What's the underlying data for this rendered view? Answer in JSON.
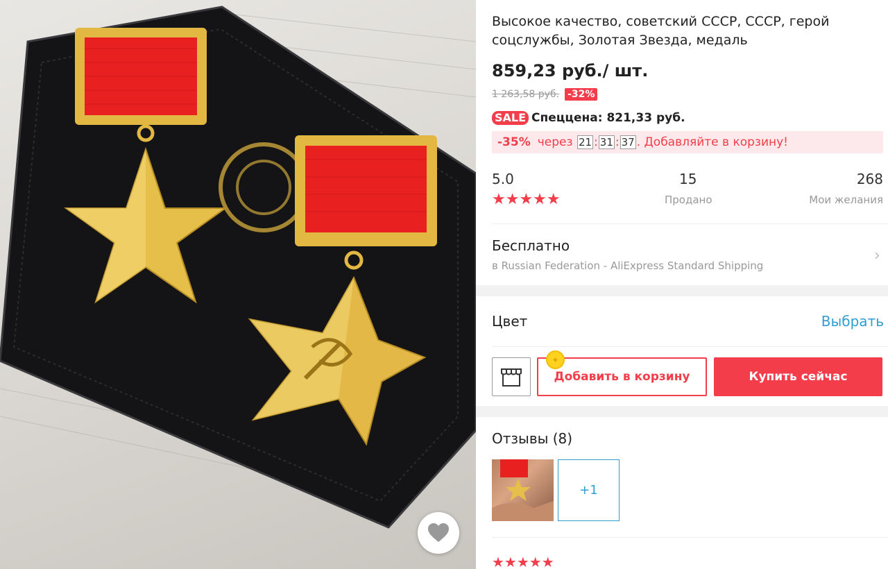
{
  "product": {
    "title": "Высокое качество, советский СССР, СССР, герой соцслужбы, Золотая Звезда, медаль",
    "price": "859,23 руб./ шт.",
    "old_price": "1 263,58 руб.",
    "discount": "-32%",
    "sale_badge": "SALE",
    "special_price": "Спеццена: 821,33 руб."
  },
  "promo": {
    "percent": "-35%",
    "prefix": "через",
    "timer": {
      "h": "21",
      "sep1": ":",
      "m": "31",
      "sep2": ":",
      "s": "37"
    },
    "suffix": ". Добавляйте в корзину!"
  },
  "stats": {
    "rating": "5.0",
    "stars": "★★★★★",
    "sold_value": "15",
    "sold_label": "Продано",
    "wish_value": "268",
    "wish_label": "Мои желания"
  },
  "shipping": {
    "title": "Бесплатно",
    "subtitle": "в Russian Federation - AliExpress Standard Shipping",
    "chevron": "›"
  },
  "color": {
    "label": "Цвет",
    "action": "Выбрать"
  },
  "actions": {
    "add_to_cart": "Добавить в корзину",
    "buy_now": "Купить сейчас"
  },
  "reviews": {
    "title": "Отзывы (8)",
    "more": "+1",
    "stars": "★★★★★"
  },
  "colors": {
    "accent": "#f33d4a",
    "link": "#2f9ed3",
    "promo_bg": "#fde9ec"
  },
  "icons": [
    "heart-icon",
    "store-icon",
    "chevron-right-icon",
    "star-icon"
  ]
}
